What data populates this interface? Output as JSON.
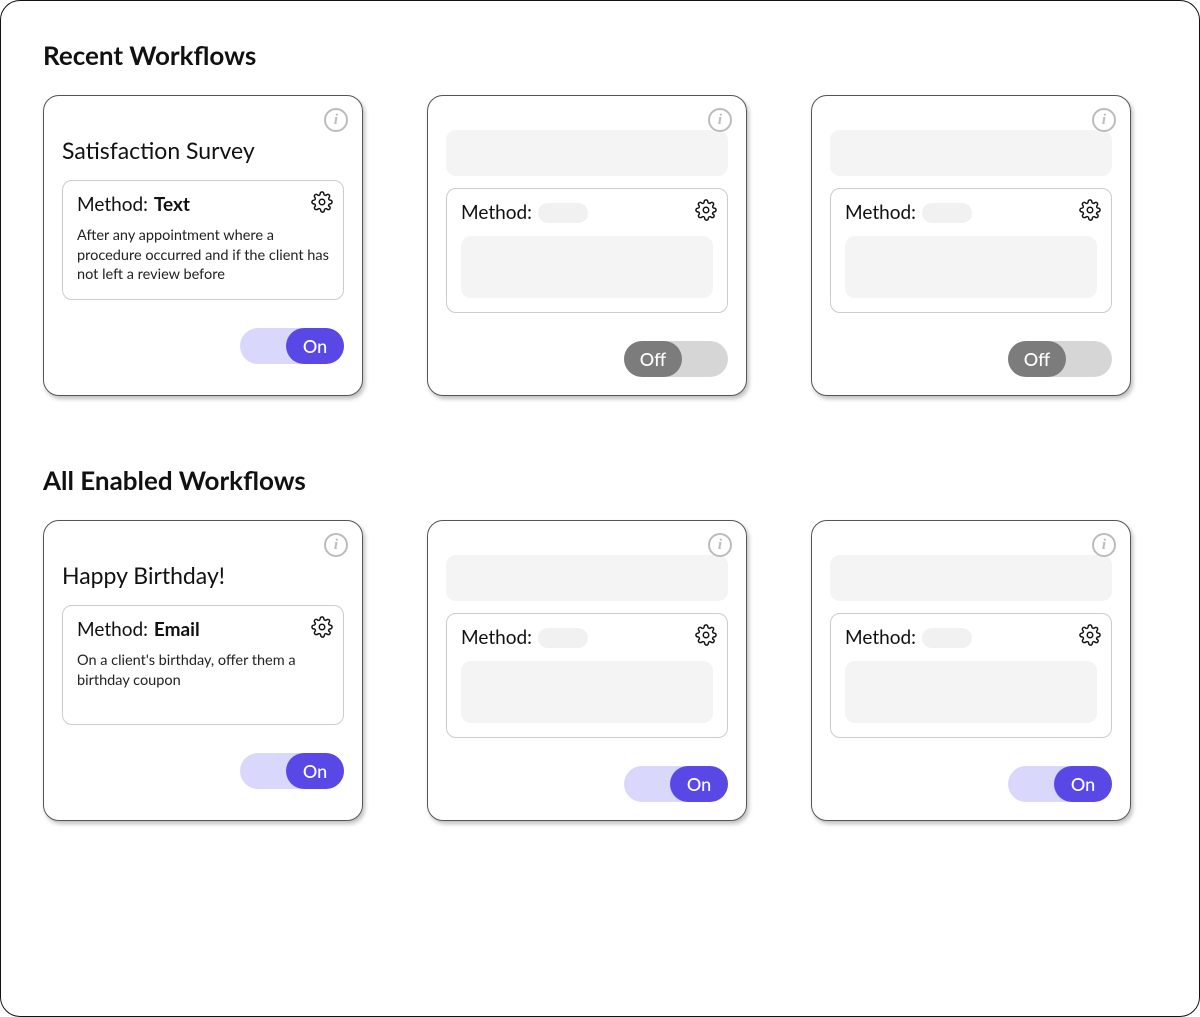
{
  "sections": {
    "recent_title": "Recent Workflows",
    "enabled_title": "All Enabled Workflows"
  },
  "labels": {
    "method_prefix": "Method:",
    "toggle_on": "On",
    "toggle_off": "Off"
  },
  "recent": [
    {
      "title": "Satisfaction Survey",
      "method": "Text",
      "description": "After any appointment where a procedure occurred and if the client has not left a review before",
      "state": "on",
      "placeholder": false
    },
    {
      "state": "off",
      "placeholder": true
    },
    {
      "state": "off",
      "placeholder": true
    }
  ],
  "enabled": [
    {
      "title": "Happy Birthday!",
      "method": "Email",
      "description": "On a client's birthday, offer them a birthday coupon",
      "state": "on",
      "placeholder": false
    },
    {
      "state": "on",
      "placeholder": true
    },
    {
      "state": "on",
      "placeholder": true
    }
  ]
}
